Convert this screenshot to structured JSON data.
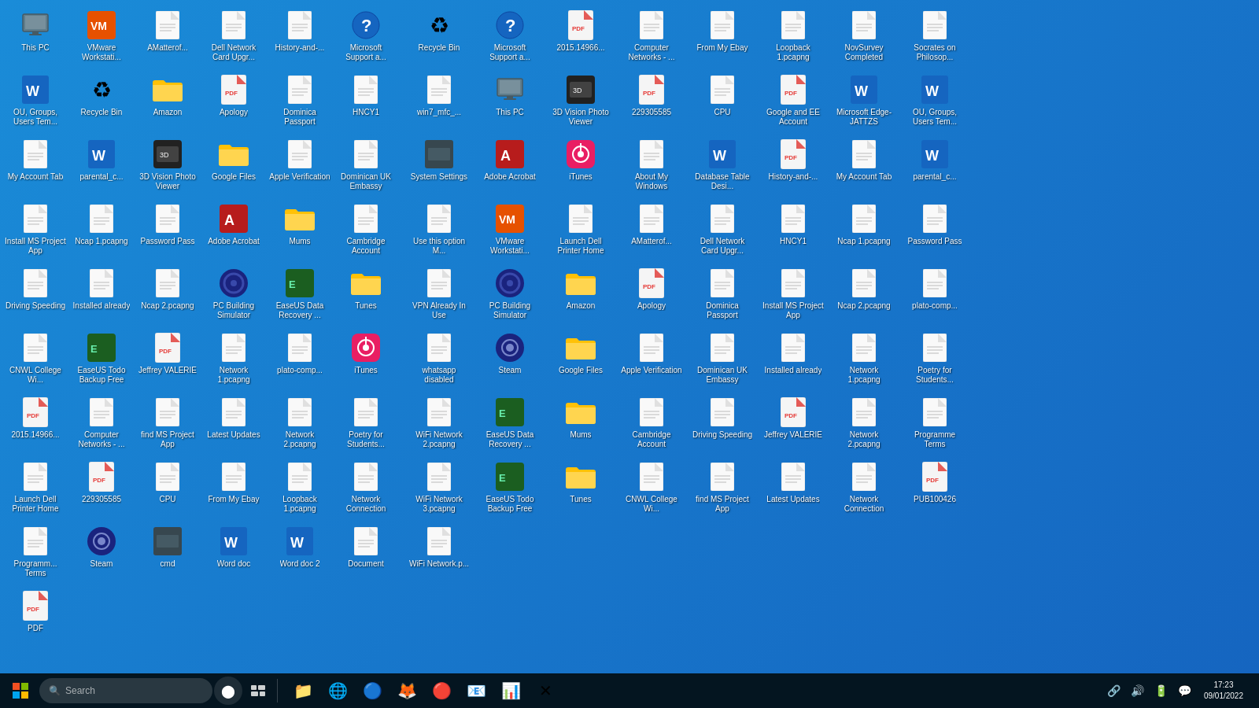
{
  "desktop": {
    "left_icons": [
      {
        "id": "this-pc",
        "label": "This PC",
        "type": "monitor"
      },
      {
        "id": "vmware",
        "label": "VMware Workstati...",
        "type": "vmware"
      },
      {
        "id": "amatterof",
        "label": "AMatterof...",
        "type": "doc"
      },
      {
        "id": "dell-network-card",
        "label": "Dell Network Card Upgr...",
        "type": "doc"
      },
      {
        "id": "history-and",
        "label": "History-and-...",
        "type": "doc"
      },
      {
        "id": "ms-support",
        "label": "Microsoft Support a...",
        "type": "question"
      },
      {
        "id": "ou-groups",
        "label": "OU, Groups, Users Tem...",
        "type": "word"
      },
      {
        "id": "recycle-bin",
        "label": "Recycle Bin",
        "type": "recycle"
      },
      {
        "id": "amazon",
        "label": "Amazon",
        "type": "folder"
      },
      {
        "id": "apology",
        "label": "Apology",
        "type": "pdf"
      },
      {
        "id": "dominica-passport",
        "label": "Dominica Passport",
        "type": "doc"
      },
      {
        "id": "hncy1",
        "label": "HNCY1",
        "type": "doc"
      },
      {
        "id": "my-account-tab",
        "label": "My Account Tab",
        "type": "doc"
      },
      {
        "id": "parental-c",
        "label": "parental_c...",
        "type": "word"
      },
      {
        "id": "3dvision",
        "label": "3D Vision Photo Viewer",
        "type": "3dvision"
      },
      {
        "id": "google-files",
        "label": "Google Files",
        "type": "folder"
      },
      {
        "id": "apple-verification",
        "label": "Apple Verification",
        "type": "doc"
      },
      {
        "id": "dominican-uk-embassy-l",
        "label": "Dominican UK Embassy",
        "type": "doc"
      },
      {
        "id": "install-ms-project-l",
        "label": "Install MS Project App",
        "type": "doc"
      },
      {
        "id": "ncap1-l",
        "label": "Ncap 1.pcapng",
        "type": "doc"
      },
      {
        "id": "password-pass-l",
        "label": "Password Pass",
        "type": "doc"
      },
      {
        "id": "adobe-acrobat-l",
        "label": "Adobe Acrobat",
        "type": "adobe"
      },
      {
        "id": "mums",
        "label": "Mums",
        "type": "folder"
      },
      {
        "id": "cambridge-account",
        "label": "Cambridge Account",
        "type": "doc"
      },
      {
        "id": "driving-speeding",
        "label": "Driving Speeding",
        "type": "doc"
      },
      {
        "id": "installed-already",
        "label": "Installed already",
        "type": "doc"
      },
      {
        "id": "ncap2-l",
        "label": "Ncap 2.pcapng",
        "type": "doc"
      },
      {
        "id": "pc-building-sim-l",
        "label": "PC Building Simulator",
        "type": "pcbuild"
      },
      {
        "id": "easeus-data",
        "label": "EaseUS Data Recovery ...",
        "type": "easeus"
      },
      {
        "id": "tunes",
        "label": "Tunes",
        "type": "folder"
      },
      {
        "id": "cnwl-college",
        "label": "CNWL College Wi...",
        "type": "doc"
      },
      {
        "id": "easeus-todo",
        "label": "EaseUS Todo Backup Free",
        "type": "easeus"
      },
      {
        "id": "jeffrey-valerie",
        "label": "Jeffrey VALERIE",
        "type": "pdf"
      },
      {
        "id": "network1",
        "label": "Network 1.pcapng",
        "type": "doc"
      },
      {
        "id": "plato-comp",
        "label": "plato-comp...",
        "type": "doc"
      },
      {
        "id": "itunes-l",
        "label": "iTunes",
        "type": "itunes"
      },
      {
        "id": "2015-14966",
        "label": "2015.14966...",
        "type": "pdf"
      },
      {
        "id": "computer-networks",
        "label": "Computer Networks - ...",
        "type": "doc"
      },
      {
        "id": "find-ms-project-l",
        "label": "find MS Project App",
        "type": "doc"
      },
      {
        "id": "latest-updates-l",
        "label": "Latest Updates",
        "type": "doc"
      },
      {
        "id": "network2-l",
        "label": "Network 2.pcapng",
        "type": "doc"
      },
      {
        "id": "poetry-students-l",
        "label": "Poetry for Students...",
        "type": "doc"
      },
      {
        "id": "launch-dell-l",
        "label": "Launch Dell Printer Home",
        "type": "doc"
      },
      {
        "id": "229305585-l",
        "label": "229305585",
        "type": "pdf"
      },
      {
        "id": "cpu-l",
        "label": "CPU",
        "type": "doc"
      },
      {
        "id": "from-my-ebay-l",
        "label": "From My Ebay",
        "type": "doc"
      },
      {
        "id": "loopback1-l",
        "label": "Loopback 1.pcapng",
        "type": "doc"
      },
      {
        "id": "network-connection-l",
        "label": "Network Connection",
        "type": "doc"
      },
      {
        "id": "programm-terms-l",
        "label": "Programm... Terms",
        "type": "doc"
      },
      {
        "id": "steam-l",
        "label": "Steam",
        "type": "steam"
      },
      {
        "id": "cmd-l",
        "label": "cmd",
        "type": "system"
      },
      {
        "id": "word1-l",
        "label": "Word doc",
        "type": "word"
      },
      {
        "id": "word2-l",
        "label": "Word doc 2",
        "type": "word"
      },
      {
        "id": "doc1-l",
        "label": "Document",
        "type": "doc"
      },
      {
        "id": "pdf-l",
        "label": "PDF",
        "type": "pdf"
      }
    ],
    "right_icons": [
      {
        "id": "recycle-bin-r",
        "label": "Recycle Bin",
        "type": "recycle"
      },
      {
        "id": "ms-support-r",
        "label": "Microsoft Support a...",
        "type": "question"
      },
      {
        "id": "2015-14966-r",
        "label": "2015.14966...",
        "type": "pdf"
      },
      {
        "id": "computer-networks-r",
        "label": "Computer Networks - ...",
        "type": "doc"
      },
      {
        "id": "from-my-ebay-r",
        "label": "From My Ebay",
        "type": "doc"
      },
      {
        "id": "loopback1-r",
        "label": "Loopback 1.pcapng",
        "type": "doc"
      },
      {
        "id": "novsurvey-r",
        "label": "NovSurvey Completed",
        "type": "doc"
      },
      {
        "id": "socrates-r",
        "label": "Socrates on Philosop...",
        "type": "doc"
      },
      {
        "id": "win7-r",
        "label": "win7_mfc_...",
        "type": "doc"
      },
      {
        "id": "this-pc-r",
        "label": "This PC",
        "type": "monitor"
      },
      {
        "id": "3dvision-r",
        "label": "3D Vision Photo Viewer",
        "type": "3dvision"
      },
      {
        "id": "229305585-r",
        "label": "229305585",
        "type": "pdf"
      },
      {
        "id": "cpu-r",
        "label": "CPU",
        "type": "doc"
      },
      {
        "id": "google-ee-r",
        "label": "Google and EE Account",
        "type": "pdf"
      },
      {
        "id": "ms-edge-r",
        "label": "Microsoft Edge-JATTZS",
        "type": "word"
      },
      {
        "id": "ou-groups-r",
        "label": "OU, Groups, Users Tem...",
        "type": "word"
      },
      {
        "id": "system-settings-r",
        "label": "System Settings",
        "type": "system"
      },
      {
        "id": "adobe-r",
        "label": "Adobe Acrobat",
        "type": "adobe"
      },
      {
        "id": "itunes-r",
        "label": "iTunes",
        "type": "itunes"
      },
      {
        "id": "about-my-windows-r",
        "label": "About My Windows",
        "type": "doc"
      },
      {
        "id": "db-table-r",
        "label": "Database Table Desi...",
        "type": "word"
      },
      {
        "id": "history-r",
        "label": "History-and-...",
        "type": "pdf"
      },
      {
        "id": "my-account-tab-r",
        "label": "My Account Tab",
        "type": "doc"
      },
      {
        "id": "parental-c-r",
        "label": "parental_c...",
        "type": "word"
      },
      {
        "id": "use-this-r",
        "label": "Use this option M...",
        "type": "doc"
      },
      {
        "id": "vmware-r",
        "label": "VMware Workstati...",
        "type": "vmware"
      },
      {
        "id": "launch-dell-r",
        "label": "Launch Dell Printer Home",
        "type": "doc"
      },
      {
        "id": "amatterof-r",
        "label": "AMatterof...",
        "type": "doc"
      },
      {
        "id": "dell-network-r",
        "label": "Dell Network Card Upgr...",
        "type": "doc"
      },
      {
        "id": "hncy1-r",
        "label": "HNCY1",
        "type": "doc"
      },
      {
        "id": "ncap1-r",
        "label": "Ncap 1.pcapng",
        "type": "doc"
      },
      {
        "id": "password-pass-r",
        "label": "Password Pass",
        "type": "doc"
      },
      {
        "id": "vpn-r",
        "label": "VPN Already In Use",
        "type": "doc"
      },
      {
        "id": "pcbuild-r",
        "label": "PC Building Simulator",
        "type": "pcbuild"
      },
      {
        "id": "amazon-r",
        "label": "Amazon",
        "type": "folder"
      },
      {
        "id": "apology-r",
        "label": "Apology",
        "type": "pdf"
      },
      {
        "id": "dominica-passport-r",
        "label": "Dominica Passport",
        "type": "doc"
      },
      {
        "id": "install-ms-r",
        "label": "Install MS Project App",
        "type": "doc"
      },
      {
        "id": "ncap2-r",
        "label": "Ncap 2.pcapng",
        "type": "doc"
      },
      {
        "id": "plato-comp-r",
        "label": "plato-comp...",
        "type": "doc"
      },
      {
        "id": "whatsapp-r",
        "label": "whatsapp disabled",
        "type": "doc"
      },
      {
        "id": "steam-r",
        "label": "Steam",
        "type": "steam"
      },
      {
        "id": "google-files-r",
        "label": "Google Files",
        "type": "folder"
      },
      {
        "id": "apple-verification-r",
        "label": "Apple Verification",
        "type": "doc"
      },
      {
        "id": "dominican-uk-r",
        "label": "Dominican UK Embassy",
        "type": "doc"
      },
      {
        "id": "installed-r",
        "label": "Installed already",
        "type": "doc"
      },
      {
        "id": "network1-r",
        "label": "Network 1.pcapng",
        "type": "doc"
      },
      {
        "id": "poetry-r",
        "label": "Poetry for Students...",
        "type": "doc"
      },
      {
        "id": "wifi-network2-r",
        "label": "WiFi Network 2.pcapng",
        "type": "doc"
      },
      {
        "id": "easeus-r",
        "label": "EaseUS Data Recovery ...",
        "type": "easeus"
      },
      {
        "id": "mums-r",
        "label": "Mums",
        "type": "folder"
      },
      {
        "id": "cambridge-r",
        "label": "Cambridge Account",
        "type": "doc"
      },
      {
        "id": "driving-r",
        "label": "Driving Speeding",
        "type": "doc"
      },
      {
        "id": "jeffrey-r",
        "label": "Jeffrey VALERIE",
        "type": "pdf"
      },
      {
        "id": "network2-r",
        "label": "Network 2.pcapng",
        "type": "doc"
      },
      {
        "id": "programm-r",
        "label": "Programme Terms",
        "type": "doc"
      },
      {
        "id": "wifi-network3-r",
        "label": "WiFi Network 3.pcapng",
        "type": "doc"
      },
      {
        "id": "easeus-todo-r",
        "label": "EaseUS Todo Backup Free",
        "type": "easeus"
      },
      {
        "id": "tunes-r",
        "label": "Tunes",
        "type": "folder"
      },
      {
        "id": "cnwl-r",
        "label": "CNWL College Wi...",
        "type": "doc"
      },
      {
        "id": "find-ms-r",
        "label": "find MS Project App",
        "type": "doc"
      },
      {
        "id": "latest-updates-r",
        "label": "Latest Updates",
        "type": "doc"
      },
      {
        "id": "network-conn-r",
        "label": "Network Connection",
        "type": "doc"
      },
      {
        "id": "pub100426-r",
        "label": "PUB100426",
        "type": "pdf"
      },
      {
        "id": "wifi-network-p-r",
        "label": "WiFi Network.p...",
        "type": "doc"
      }
    ]
  },
  "taskbar": {
    "start_label": "⊞",
    "search_placeholder": "Search",
    "apps": [
      {
        "id": "taskbar-fileexplorer",
        "icon": "📁",
        "label": "File Explorer"
      },
      {
        "id": "taskbar-edge",
        "icon": "🌐",
        "label": "Edge"
      },
      {
        "id": "taskbar-ie",
        "icon": "🔵",
        "label": "Internet Explorer"
      },
      {
        "id": "taskbar-firefox",
        "icon": "🦊",
        "label": "Firefox"
      },
      {
        "id": "taskbar-chrome",
        "icon": "🔴",
        "label": "Chrome"
      },
      {
        "id": "taskbar-outlook",
        "icon": "📧",
        "label": "Outlook"
      },
      {
        "id": "taskbar-powerpoint",
        "icon": "🔴",
        "label": "PowerPoint"
      },
      {
        "id": "taskbar-close",
        "icon": "✕",
        "label": "Close"
      }
    ],
    "clock": {
      "time": "17:23",
      "date": "09/01/2022"
    }
  }
}
